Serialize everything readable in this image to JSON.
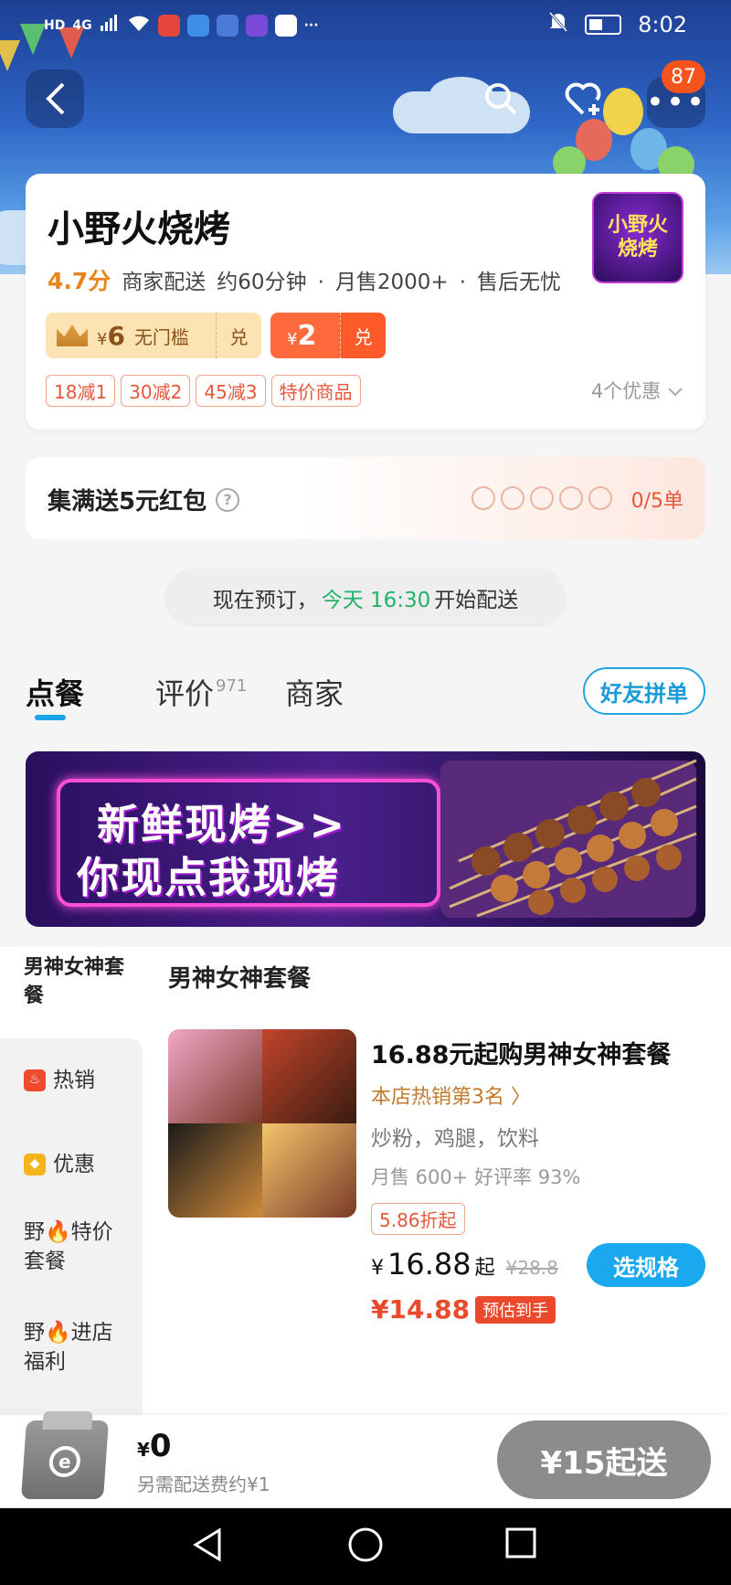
{
  "status_bar": {
    "network_hd": "HD",
    "network_4g": "4G",
    "time": "8:02",
    "dots": "···"
  },
  "nav": {
    "more_badge": "87"
  },
  "store": {
    "name": "小野火烧烤",
    "logo_text_1": "小野火",
    "logo_text_2": "烧烤",
    "rating": "4.7分",
    "delivery": "商家配送",
    "time": "约60分钟",
    "monthly_sales": "月售2000+",
    "after_sale": "售后无忧",
    "sep": "·"
  },
  "coupons": [
    {
      "currency": "¥",
      "amount": "6",
      "label": "无门槛",
      "action": "兑"
    },
    {
      "currency": "¥",
      "amount": "2",
      "action": "兑"
    }
  ],
  "promo_tags": [
    "18减1",
    "30减2",
    "45减3",
    "特价商品"
  ],
  "offers_link": "4个优惠",
  "collect": {
    "title": "集满送5元红包",
    "progress": "0/5单",
    "filled": 0,
    "total": 5
  },
  "preorder": {
    "prefix": "现在预订，",
    "day_time": "今天 16:30",
    "suffix": "开始配送"
  },
  "tabs": [
    {
      "label": "点餐",
      "active": true
    },
    {
      "label": "评价",
      "count": "971"
    },
    {
      "label": "商家"
    }
  ],
  "group_order_button": "好友拼单",
  "banner": {
    "line1": "新鲜现烤>>",
    "line2": "你现点我现烤"
  },
  "categories": [
    {
      "label": "男神女神套餐",
      "selected": true
    },
    {
      "label": "热销",
      "icon": "fire-icon"
    },
    {
      "label": "优惠",
      "icon": "tag-icon"
    },
    {
      "label": "野🔥特价套餐"
    },
    {
      "label": "野🔥进店福利"
    }
  ],
  "section_title": "男神女神套餐",
  "product": {
    "name": "16.88元起购男神女神套餐",
    "rank": "本店热销第3名 〉",
    "desc": "炒粉，鸡腿，饮料",
    "sales": "月售 600+ 好评率 93%",
    "discount": "5.86折起",
    "currency": "¥",
    "price": "16.88",
    "price_suffix": "起",
    "original_price": "¥28.8",
    "estimated_price": "¥14.88",
    "estimated_label": "预估到手",
    "spec_button": "选规格"
  },
  "cart": {
    "currency": "¥",
    "total": "0",
    "fee_note": "另需配送费约¥1",
    "min_button": "¥15起送"
  },
  "colors": {
    "accent_blue": "#1aa8ee",
    "price_red": "#ea4a2b",
    "rating_orange": "#e8841c",
    "green": "#21b26a"
  }
}
